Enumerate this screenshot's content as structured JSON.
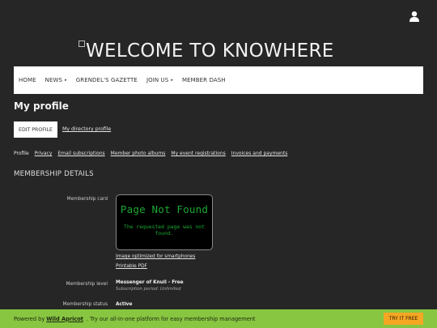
{
  "header": {
    "site_title": "WELCOME TO KNOWHERE"
  },
  "icons": {
    "user": "user-icon",
    "broken_image": "broken-image-icon",
    "dropdown": "chevron-right-icon"
  },
  "nav": {
    "items": [
      {
        "label": "HOME",
        "has_dropdown": false
      },
      {
        "label": "NEWS",
        "has_dropdown": true
      },
      {
        "label": "GRENDEL'S GAZETTE",
        "has_dropdown": false
      },
      {
        "label": "JOIN US",
        "has_dropdown": true
      },
      {
        "label": "MEMBER DASH",
        "has_dropdown": false
      }
    ],
    "dropdown_glyph": "▸"
  },
  "page": {
    "title": "My profile",
    "edit_button": "EDIT PROFILE",
    "directory_link": "My directory profile"
  },
  "subnav": {
    "items": [
      {
        "label": "Profile",
        "link": false
      },
      {
        "label": "Privacy",
        "link": true
      },
      {
        "label": "Email subscriptions",
        "link": true
      },
      {
        "label": "Member photo albums",
        "link": true
      },
      {
        "label": "My event registrations",
        "link": true
      },
      {
        "label": "Invoices and payments",
        "link": true
      }
    ]
  },
  "membership": {
    "heading": "MEMBERSHIP DETAILS",
    "card_label": "Membership card",
    "card_error_title": "Page Not Found",
    "card_error_message": "The requested page was not found.",
    "smartphone_link": "Image optimized for smartphones",
    "pdf_link": "Printable PDF",
    "level_label": "Membership level",
    "level_value": "Messenger of Knull - Free",
    "subscription_period": "Subscription period: Unlimited",
    "status_label": "Membership status",
    "status_value": "Active"
  },
  "footer": {
    "prefix": "Powered by",
    "brand": "Wild Apricot",
    "suffix": ". Try our all-in-one platform for easy membership management",
    "cta": "TRY IT FREE"
  },
  "colors": {
    "background": "#262626",
    "nav_background": "#ffffff",
    "footer_background": "#88c541",
    "cta_background": "#f5a623",
    "terminal_text": "#19a832"
  }
}
